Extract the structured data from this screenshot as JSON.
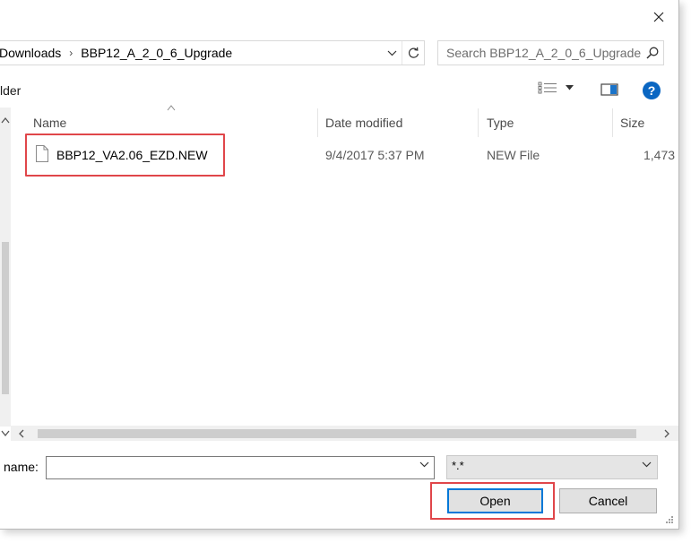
{
  "window": {
    "close_glyph": "✕"
  },
  "address_bar": {
    "crumbs": [
      "Downloads",
      "BBP12_A_2_0_6_Upgrade"
    ],
    "separator": "›"
  },
  "search": {
    "placeholder": "Search BBP12_A_2_0_6_Upgrade"
  },
  "toolbar": {
    "new_folder_label": "lder"
  },
  "file_list": {
    "columns": [
      "Name",
      "Date modified",
      "Type",
      "Size"
    ],
    "rows": [
      {
        "name": "BBP12_VA2.06_EZD.NEW",
        "date_modified": "9/4/2017 5:37 PM",
        "type": "NEW File",
        "size": "1,473"
      }
    ]
  },
  "bottom": {
    "file_name_label": "name:",
    "file_name_value": "",
    "file_type_filter": "*.*",
    "open_label": "Open",
    "cancel_label": "Cancel"
  },
  "colors": {
    "highlight": "#e0464a",
    "accent": "#0078d7",
    "help": "#0a66c2"
  }
}
